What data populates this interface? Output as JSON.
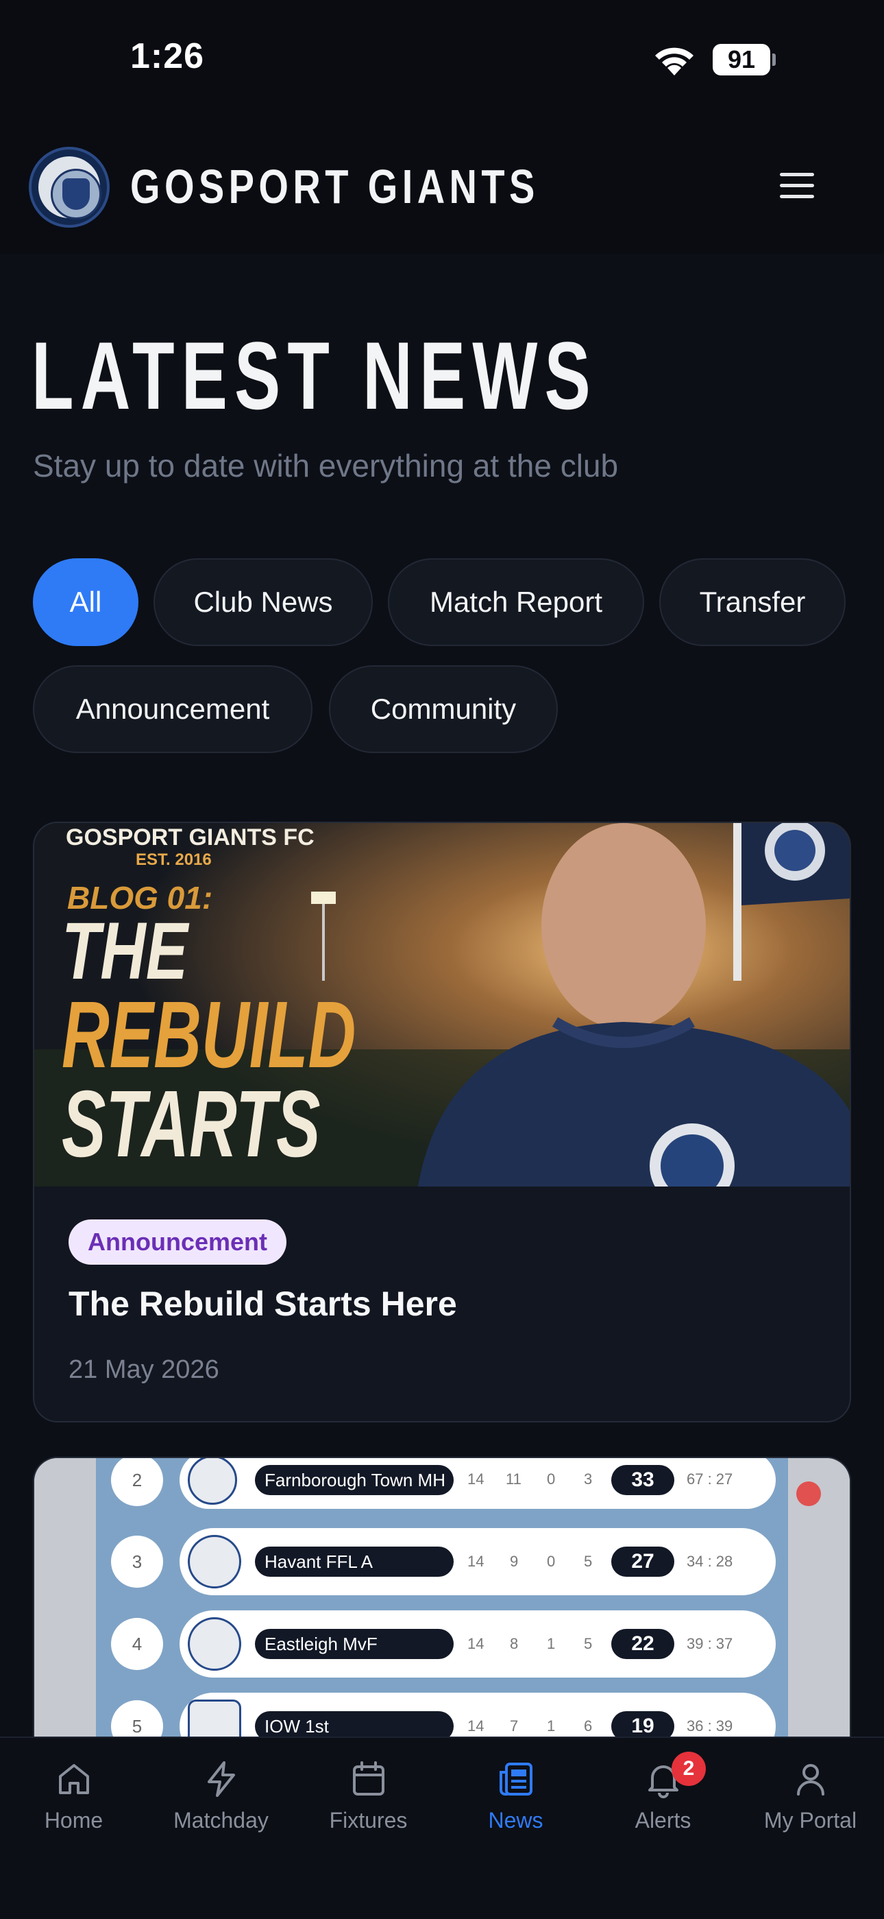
{
  "status_bar": {
    "time": "1:26",
    "battery": "91"
  },
  "header": {
    "brand": "GOSPORT GIANTS"
  },
  "page": {
    "title": "LATEST NEWS",
    "subtitle": "Stay up to date with everything at the club"
  },
  "filters": [
    {
      "label": "All",
      "active": true
    },
    {
      "label": "Club News"
    },
    {
      "label": "Match Report"
    },
    {
      "label": "Transfer"
    },
    {
      "label": "Announcement"
    },
    {
      "label": "Community"
    }
  ],
  "articles": [
    {
      "category": "Announcement",
      "title": "The Rebuild Starts Here",
      "date": "21 May 2026",
      "image_text": {
        "club": "GOSPORT GIANTS FC",
        "est": "EST. 2016",
        "blog": "BLOG 01:",
        "line1": "THE",
        "line2": "REBUILD",
        "line3": "STARTS"
      }
    },
    {
      "image_table": {
        "rows": [
          {
            "pos": "2",
            "team": "Farnborough Town MH",
            "p": "14",
            "w": "11",
            "d": "0",
            "l": "3",
            "pts": "33",
            "gd": "67 : 27"
          },
          {
            "pos": "3",
            "team": "Havant FFL A",
            "p": "14",
            "w": "9",
            "d": "0",
            "l": "5",
            "pts": "27",
            "gd": "34 : 28"
          },
          {
            "pos": "4",
            "team": "Eastleigh MvF",
            "p": "14",
            "w": "8",
            "d": "1",
            "l": "5",
            "pts": "22",
            "gd": "39 : 37"
          },
          {
            "pos": "5",
            "team": "IOW 1st",
            "p": "14",
            "w": "7",
            "d": "1",
            "l": "6",
            "pts": "19",
            "gd": "36 : 39"
          }
        ]
      }
    }
  ],
  "bottom_nav": [
    {
      "label": "Home",
      "icon": "home-icon"
    },
    {
      "label": "Matchday",
      "icon": "lightning-icon"
    },
    {
      "label": "Fixtures",
      "icon": "calendar-icon"
    },
    {
      "label": "News",
      "icon": "newspaper-icon",
      "active": true
    },
    {
      "label": "Alerts",
      "icon": "bell-icon",
      "badge": "2"
    },
    {
      "label": "My Portal",
      "icon": "user-icon"
    }
  ],
  "colors": {
    "accent": "#2f7bf6",
    "background": "#0c0f16",
    "card": "#121620",
    "badge_bg": "#f0e7ff",
    "badge_text": "#6b2fb6",
    "alert": "#e5323b"
  }
}
